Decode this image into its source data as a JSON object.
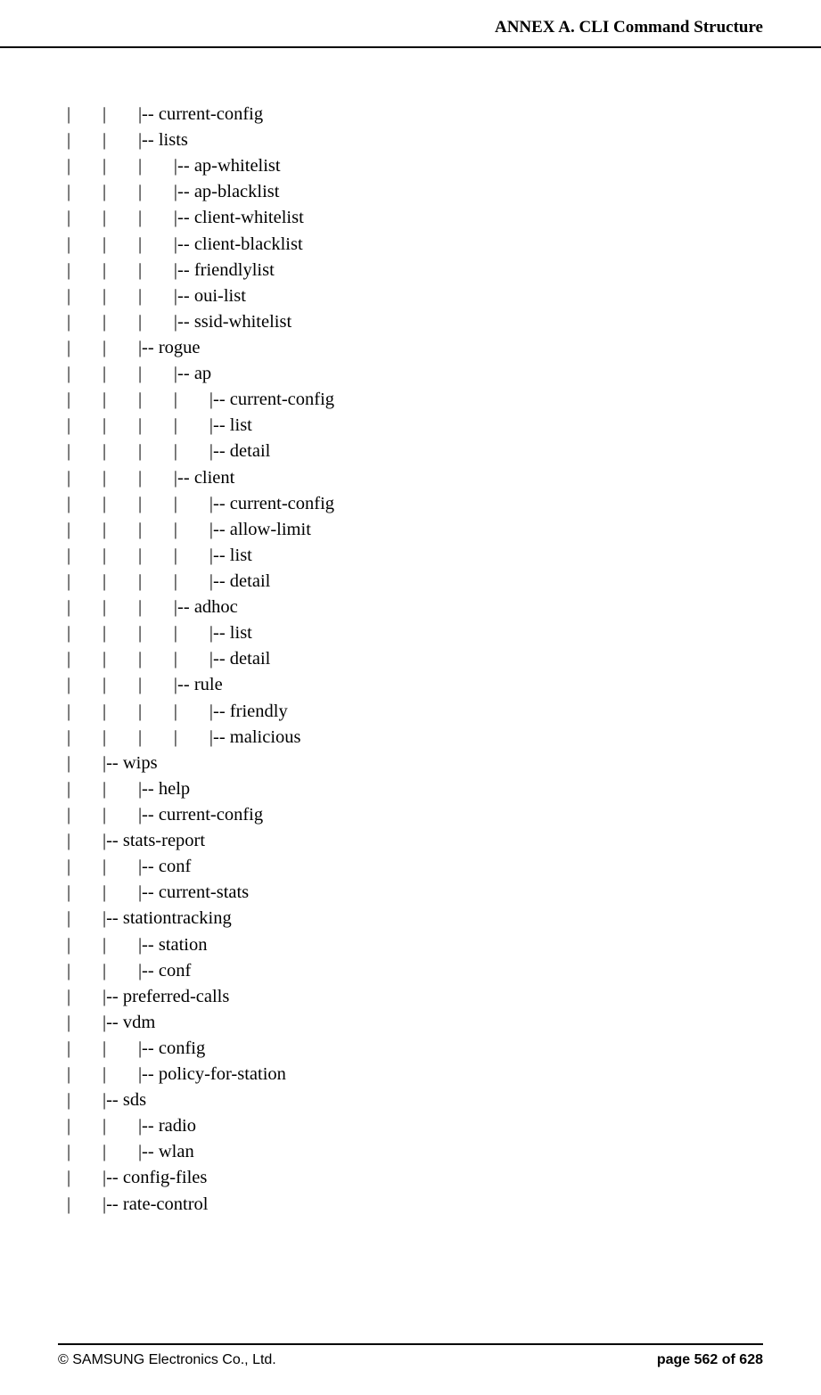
{
  "header": {
    "title": "ANNEX A. CLI Command Structure"
  },
  "tree": [
    "|       |       |-- current-config",
    "|       |       |-- lists",
    "|       |       |       |-- ap-whitelist",
    "|       |       |       |-- ap-blacklist",
    "|       |       |       |-- client-whitelist",
    "|       |       |       |-- client-blacklist",
    "|       |       |       |-- friendlylist",
    "|       |       |       |-- oui-list",
    "|       |       |       |-- ssid-whitelist",
    "|       |       |-- rogue",
    "|       |       |       |-- ap",
    "|       |       |       |       |-- current-config",
    "|       |       |       |       |-- list",
    "|       |       |       |       |-- detail",
    "|       |       |       |-- client",
    "|       |       |       |       |-- current-config",
    "|       |       |       |       |-- allow-limit",
    "|       |       |       |       |-- list",
    "|       |       |       |       |-- detail",
    "|       |       |       |-- adhoc",
    "|       |       |       |       |-- list",
    "|       |       |       |       |-- detail",
    "|       |       |       |-- rule",
    "|       |       |       |       |-- friendly",
    "|       |       |       |       |-- malicious",
    "|       |-- wips",
    "|       |       |-- help",
    "|       |       |-- current-config",
    "|       |-- stats-report",
    "|       |       |-- conf",
    "|       |       |-- current-stats",
    "|       |-- stationtracking",
    "|       |       |-- station",
    "|       |       |-- conf",
    "|       |-- preferred-calls",
    "|       |-- vdm",
    "|       |       |-- config",
    "|       |       |-- policy-for-station",
    "|       |-- sds",
    "|       |       |-- radio",
    "|       |       |-- wlan",
    "|       |-- config-files",
    "|       |-- rate-control"
  ],
  "footer": {
    "copyright": "© SAMSUNG Electronics Co., Ltd.",
    "page": "page 562 of 628"
  }
}
